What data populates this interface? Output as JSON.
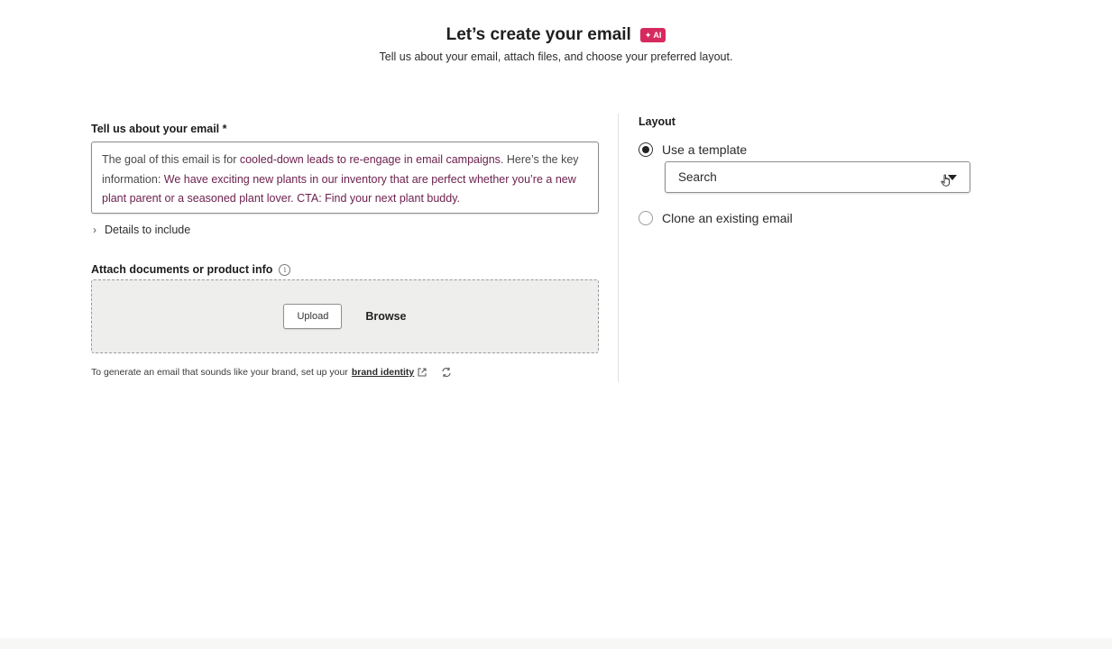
{
  "header": {
    "title": "Let’s create your email",
    "ai_badge": "AI",
    "subtitle": "Tell us about your email, attach files, and choose your preferred layout."
  },
  "prompt": {
    "label": "Tell us about your email *",
    "text_parts": [
      "The goal of this email is for ",
      "cooled-down leads to re-engage in email campaigns",
      ". Here’s the key information: ",
      "We have exciting new plants in our inventory that are perfect whether you’re a new plant parent or a seasoned plant lover. CTA: Find your next plant buddy."
    ],
    "details_label": "Details to include"
  },
  "attach": {
    "label": "Attach documents or product info",
    "upload_label": "Upload",
    "browse_label": "Browse"
  },
  "footnote": {
    "text": "To generate an email that sounds like your brand, set up your",
    "link": "brand identity"
  },
  "layout": {
    "label": "Layout",
    "option_template": "Use a template",
    "search_value": "Search",
    "option_clone": "Clone an existing email",
    "selected": "Use a template"
  },
  "colors": {
    "ai_badge": "#d6295f",
    "highlight_text": "#6b1e4c"
  },
  "icons": [
    "sparkle-icon",
    "chevron-right-icon",
    "info-icon",
    "external-link-icon",
    "refresh-icon",
    "caret-down-icon",
    "pointer-cursor-icon"
  ]
}
